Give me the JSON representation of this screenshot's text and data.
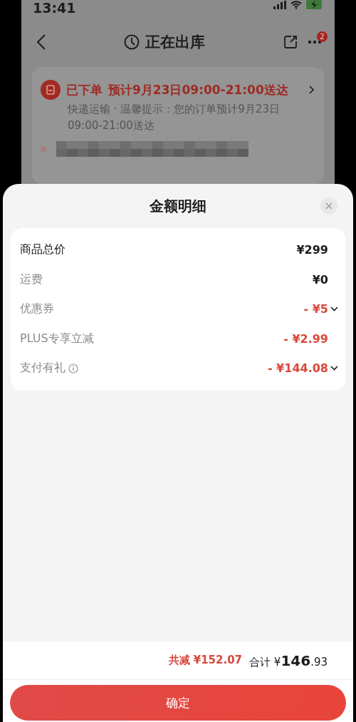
{
  "status_bar": {
    "time": "13:41"
  },
  "nav": {
    "title": "正在出库",
    "badge": "2"
  },
  "order_card": {
    "status": "已下单",
    "eta": "预计9月23日09:00-21:00送达",
    "detail_line_1": "快递运输 · 温馨提示：您的订单预计9月23日",
    "detail_line_2": "09:00-21:00送达"
  },
  "sheet": {
    "title": "金额明细",
    "rows": [
      {
        "label": "商品总价",
        "value": "¥299",
        "kind": "total",
        "expandable": false,
        "info": false
      },
      {
        "label": "运费",
        "value": "¥0",
        "kind": "charge",
        "expandable": false,
        "info": false
      },
      {
        "label": "优惠券",
        "value": "- ¥5",
        "kind": "discount",
        "expandable": true,
        "info": false
      },
      {
        "label": "PLUS专享立减",
        "value": "- ¥2.99",
        "kind": "discount",
        "expandable": false,
        "info": false
      },
      {
        "label": "支付有礼",
        "value": "- ¥144.08",
        "kind": "discount",
        "expandable": true,
        "info": true
      }
    ]
  },
  "summary": {
    "discount_label": "共减",
    "discount": "¥152.07",
    "total_label": "合计",
    "total_currency": "¥",
    "total_integer": "146",
    "total_decimal": ".93"
  },
  "confirm_button": "确定"
}
